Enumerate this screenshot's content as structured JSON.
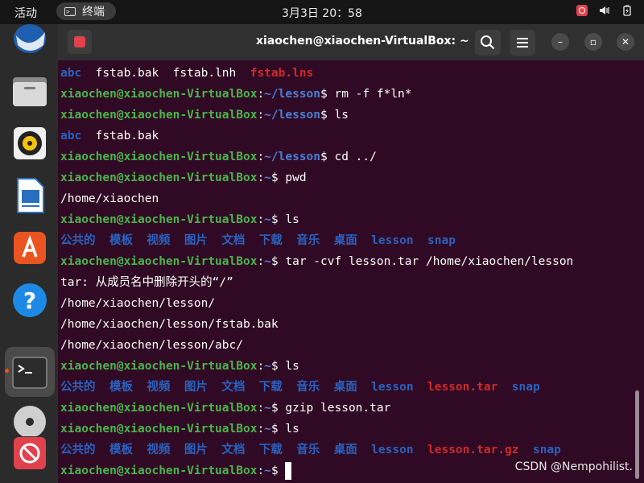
{
  "topbar": {
    "activities": "活动",
    "app_name": "终端",
    "clock": "3月3日  20：58"
  },
  "window": {
    "title": "xiaochen@xiaochen-VirtualBox: ~"
  },
  "terminal": {
    "user": "xiaochen@xiaochen-VirtualBox",
    "lines": [
      {
        "type": "out",
        "segs": [
          [
            "dir",
            "abc"
          ],
          [
            "plain",
            "  fstab.bak  fstab.lnh  "
          ],
          [
            "red",
            "fstab.lns"
          ]
        ]
      },
      {
        "type": "cmd",
        "path": "~/lesson",
        "cmd": " rm -f f*ln*"
      },
      {
        "type": "cmd",
        "path": "~/lesson",
        "cmd": " ls"
      },
      {
        "type": "out",
        "segs": [
          [
            "dir",
            "abc"
          ],
          [
            "plain",
            "  fstab.bak"
          ]
        ]
      },
      {
        "type": "cmd",
        "path": "~/lesson",
        "cmd": " cd ../"
      },
      {
        "type": "cmd",
        "path": "~",
        "cmd": " pwd"
      },
      {
        "type": "out",
        "segs": [
          [
            "plain",
            "/home/xiaochen"
          ]
        ]
      },
      {
        "type": "cmd",
        "path": "~",
        "cmd": " ls"
      },
      {
        "type": "out",
        "segs": [
          [
            "dir",
            "公共的  模板  视频  图片  文档  下载  音乐  桌面  lesson  snap"
          ]
        ]
      },
      {
        "type": "cmd",
        "path": "~",
        "cmd": " tar -cvf lesson.tar /home/xiaochen/lesson"
      },
      {
        "type": "out",
        "segs": [
          [
            "plain",
            "tar: 从成员名中删除开头的“/”"
          ]
        ]
      },
      {
        "type": "out",
        "segs": [
          [
            "plain",
            "/home/xiaochen/lesson/"
          ]
        ]
      },
      {
        "type": "out",
        "segs": [
          [
            "plain",
            "/home/xiaochen/lesson/fstab.bak"
          ]
        ]
      },
      {
        "type": "out",
        "segs": [
          [
            "plain",
            "/home/xiaochen/lesson/abc/"
          ]
        ]
      },
      {
        "type": "cmd",
        "path": "~",
        "cmd": " ls"
      },
      {
        "type": "out",
        "segs": [
          [
            "dir",
            "公共的  模板  视频  图片  文档  下载  音乐  桌面  lesson  "
          ],
          [
            "red",
            "lesson.tar"
          ],
          [
            "dir",
            "  snap"
          ]
        ]
      },
      {
        "type": "cmd",
        "path": "~",
        "cmd": " gzip lesson.tar"
      },
      {
        "type": "cmd",
        "path": "~",
        "cmd": " ls"
      },
      {
        "type": "out",
        "segs": [
          [
            "dir",
            "公共的  模板  视频  图片  文档  下载  音乐  桌面  lesson  "
          ],
          [
            "red",
            "lesson.tar.gz"
          ],
          [
            "dir",
            "  snap"
          ]
        ]
      },
      {
        "type": "prompt",
        "path": "~",
        "cmd": " "
      }
    ]
  },
  "watermark": "CSDN @Nempohilist.",
  "colors": {
    "bg": "#300a24",
    "user": "#4ab54a",
    "path": "#4a7fd6",
    "red": "#d02a2a"
  }
}
